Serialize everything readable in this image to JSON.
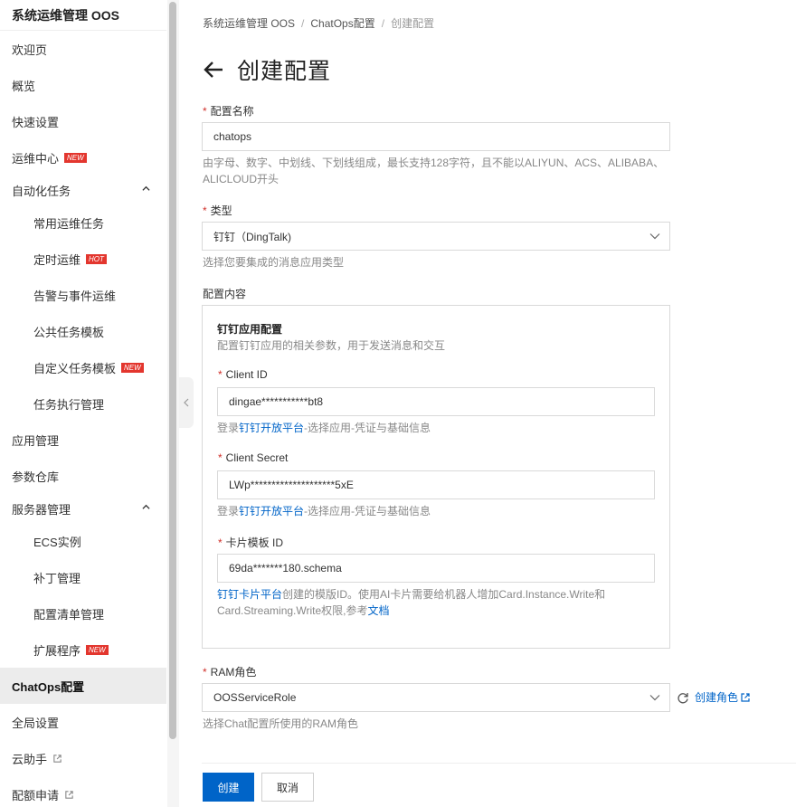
{
  "sidebar": {
    "title": "系统运维管理 OOS",
    "items": [
      {
        "label": "欢迎页"
      },
      {
        "label": "概览"
      },
      {
        "label": "快速设置"
      },
      {
        "label": "运维中心",
        "badge": "NEW"
      },
      {
        "label": "自动化任务",
        "expanded": true
      },
      {
        "label": "常用运维任务"
      },
      {
        "label": "定时运维",
        "badge": "HOT"
      },
      {
        "label": "告警与事件运维"
      },
      {
        "label": "公共任务模板"
      },
      {
        "label": "自定义任务模板",
        "badge": "NEW"
      },
      {
        "label": "任务执行管理"
      },
      {
        "label": "应用管理"
      },
      {
        "label": "参数仓库"
      },
      {
        "label": "服务器管理",
        "expanded": true
      },
      {
        "label": "ECS实例"
      },
      {
        "label": "补丁管理"
      },
      {
        "label": "配置清单管理"
      },
      {
        "label": "扩展程序",
        "badge": "NEW"
      },
      {
        "label": "ChatOps配置",
        "active": true
      },
      {
        "label": "全局设置"
      },
      {
        "label": "云助手",
        "external": true
      },
      {
        "label": "配额申请",
        "external": true
      }
    ]
  },
  "breadcrumb": [
    "系统运维管理 OOS",
    "ChatOps配置",
    "创建配置"
  ],
  "page_title": "创建配置",
  "form": {
    "name": {
      "label": "配置名称",
      "value": "chatops",
      "help": "由字母、数字、中划线、下划线组成，最长支持128字符，且不能以ALIYUN、ACS、ALIBABA、ALICLOUD开头"
    },
    "type": {
      "label": "类型",
      "value": "钉钉（DingTalk)",
      "help": "选择您要集成的消息应用类型"
    },
    "content_label": "配置内容",
    "box": {
      "title": "钉钉应用配置",
      "subtitle": "配置钉钉应用的相关参数，用于发送消息和交互",
      "client_id": {
        "label": "Client ID",
        "value": "dingae***********bt8",
        "help_prefix": "登录",
        "help_link": "钉钉开放平台",
        "help_suffix": "-选择应用-凭证与基础信息"
      },
      "client_secret": {
        "label": "Client Secret",
        "value": "LWp********************5xE",
        "help_prefix": "登录",
        "help_link": "钉钉开放平台",
        "help_suffix": "-选择应用-凭证与基础信息"
      },
      "card_template": {
        "label": "卡片模板 ID",
        "value": "69da*******180.schema",
        "help_link": "钉钉卡片平台",
        "help_middle": "创建的模版ID。使用AI卡片需要给机器人增加Card.Instance.Write和Card.Streaming.Write权限,参考",
        "help_doc": "文档"
      }
    },
    "ram_role": {
      "label": "RAM角色",
      "value": "OOSServiceRole",
      "create_link": "创建角色",
      "help": "选择Chat配置所使用的RAM角色"
    }
  },
  "buttons": {
    "create": "创建",
    "cancel": "取消"
  },
  "colors": {
    "primary": "#0064c8",
    "required": "#d0302a",
    "badge": "#e3362e"
  }
}
